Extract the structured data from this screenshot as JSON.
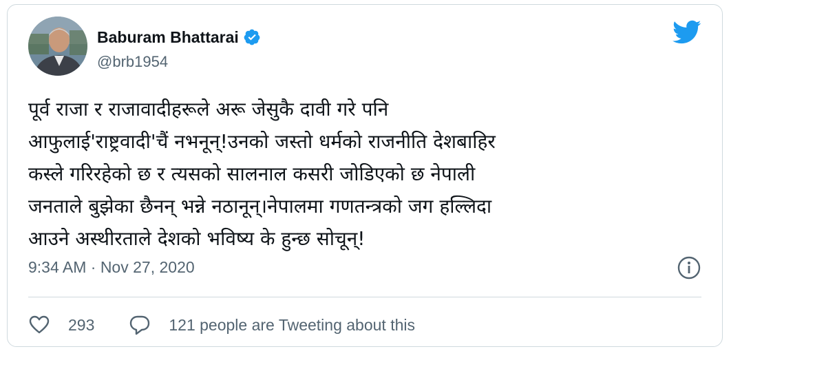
{
  "author": {
    "display_name": "Baburam Bhattarai",
    "handle": "@brb1954",
    "verified_icon": "verified-badge-icon",
    "avatar_icon": "avatar"
  },
  "tweet": {
    "text": "पूर्व राजा र राजावादीहरूले अरू जेसुकै दावी गरे पनि\nआफुलाई'राष्ट्रवादी'चैं नभनून्!उनको जस्तो धर्मको राजनीति देशबाहिर\nकस्ले गरिरहेको छ र त्यसको सालनाल कसरी जोडिएको छ नेपाली\nजनताले बुझेका छैनन् भन्ने नठानून्।नेपालमा गणतन्त्रको जग हल्लिदा\nआउने अस्थीरताले देशको भविष्य के हुन्छ सोचून्!",
    "timestamp": "9:34 AM · Nov 27, 2020"
  },
  "actions": {
    "like_count": "293",
    "reply_text": "121 people are Tweeting about this"
  },
  "icons": {
    "brand": "twitter-bird-icon",
    "info": "info-icon",
    "like": "heart-icon",
    "reply": "speech-bubble-icon"
  },
  "colors": {
    "brand_blue": "#1d9bf0",
    "text_primary": "#0f1419",
    "text_secondary": "#536471",
    "border": "#cfd9de"
  }
}
